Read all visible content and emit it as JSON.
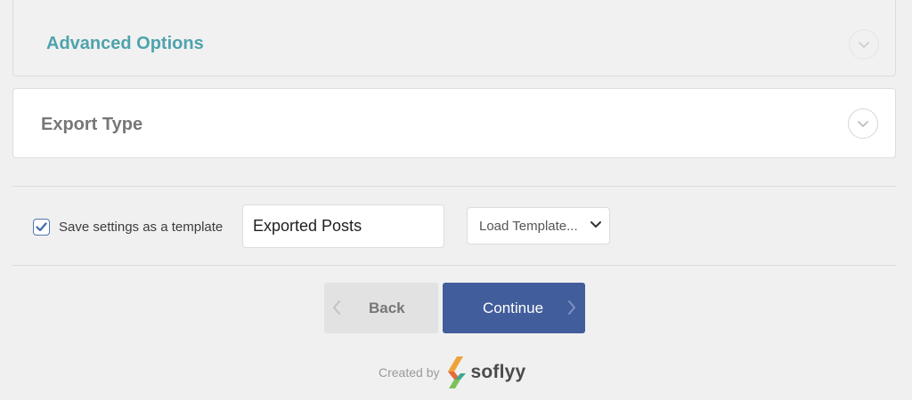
{
  "sections": {
    "advanced_options": {
      "title": "Advanced Options",
      "icon": "chevron-down-icon"
    },
    "export_type": {
      "title": "Export Type",
      "icon": "chevron-down-icon"
    }
  },
  "template": {
    "checkbox_checked": true,
    "checkbox_label": "Save settings as a template",
    "name_value": "Exported Posts",
    "load_select": {
      "selected": "Load Template...",
      "icon": "chevron-down-icon"
    }
  },
  "nav": {
    "back_label": "Back",
    "back_icon": "chevron-left-icon",
    "continue_label": "Continue",
    "continue_icon": "chevron-right-icon"
  },
  "footer": {
    "created_by": "Created by",
    "brand": "soflyy"
  },
  "colors": {
    "accent_title": "#4fa3ad",
    "continue_bg": "#425d9b",
    "back_bg": "#e2e2e2",
    "checkbox": "#5277b0",
    "page_bg": "#f0f0f0"
  }
}
